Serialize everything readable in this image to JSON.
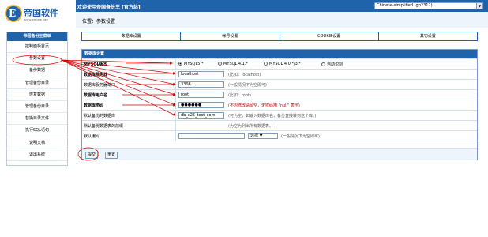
{
  "header": {
    "logo_title": "帝国软件",
    "logo_subtitle": "WWW.PHOME.NET",
    "welcome": "欢迎使用帝国备份王 [官方站]",
    "language_select": "Chinese-simplified (gb2312)"
  },
  "breadcrumb": "位置：参数设置",
  "sidebar": {
    "title": "帝国备份王菜单",
    "items": [
      {
        "label": "控制面板首页"
      },
      {
        "label": "参数设置"
      },
      {
        "label": "备份数据"
      },
      {
        "label": "管理备份目录"
      },
      {
        "label": "恢复数据"
      },
      {
        "label": "管理备份目录"
      },
      {
        "label": "替换目录文件"
      },
      {
        "label": "执行SQL语句"
      },
      {
        "label": "说明文档"
      },
      {
        "label": "退出系统"
      }
    ]
  },
  "tabs": [
    "数据库设置",
    "帐号设置",
    "COOKIE设置",
    "其它设置"
  ],
  "form": {
    "section_title": "数据库设置",
    "mysql_version": {
      "label": "MYSQL版本",
      "options": [
        "MYSQL5.*",
        "MYSQL 4.1.*",
        "MYSQL 4.0.*/3.*",
        "自动识别"
      ],
      "selected": "MYSQL5.*"
    },
    "db_server": {
      "label": "数据库服务器",
      "value": "localhost",
      "hint": "(比如：localhost)"
    },
    "db_port": {
      "label": "数据库服务器端口",
      "value": "3306",
      "hint": "(一般情况下为空即可)"
    },
    "db_user": {
      "label": "数据库用户名",
      "value": "root",
      "hint": "(比如：root)"
    },
    "db_password": {
      "label": "数据库密码",
      "value": "●●●●●●",
      "hint": "(不想修改请留空，无密码用 \"null\" 表示)"
    },
    "default_db": {
      "label": "默认备份的数据库",
      "value": "db_x25_test_com",
      "hint": "(可为空，如输入数据库名，备份直接转到这个库。)"
    },
    "default_dir": {
      "label": "默认备份数据表的前缀",
      "value": "",
      "hint": "(为空为列出所有数据表。)"
    },
    "default_charset": {
      "label": "默认编码",
      "value": "",
      "select_value": "选择",
      "hint": "(一般情况下为空即可)"
    },
    "submit_label": "提交",
    "reset_label": "重置"
  },
  "colors": {
    "header_blue": "#1f63ad",
    "annotation_red": "#d40000"
  }
}
